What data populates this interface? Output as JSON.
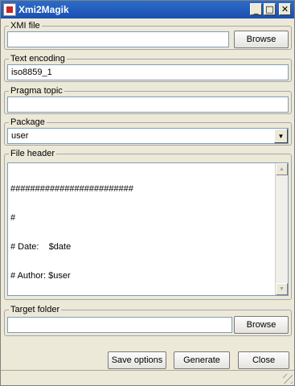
{
  "window": {
    "title": "Xmi2Magik"
  },
  "xmi_file": {
    "label": "XMI file",
    "value": "",
    "browse_label": "Browse"
  },
  "text_encoding": {
    "label": "Text encoding",
    "value": "iso8859_1"
  },
  "pragma_topic": {
    "label": "Pragma topic",
    "value": ""
  },
  "package": {
    "label": "Package",
    "selected": "user"
  },
  "file_header": {
    "label": "File header",
    "lines": [
      "#########################",
      "#",
      "# Date:    $date",
      "# Author: $user",
      "#",
      "#########################"
    ]
  },
  "target_folder": {
    "label": "Target folder",
    "value": "",
    "browse_label": "Browse"
  },
  "buttons": {
    "save_options": "Save options",
    "generate": "Generate",
    "close": "Close"
  },
  "icons": {
    "app": "app-icon",
    "minimize": "minimize-icon",
    "maximize": "maximize-icon",
    "close": "close-icon"
  }
}
